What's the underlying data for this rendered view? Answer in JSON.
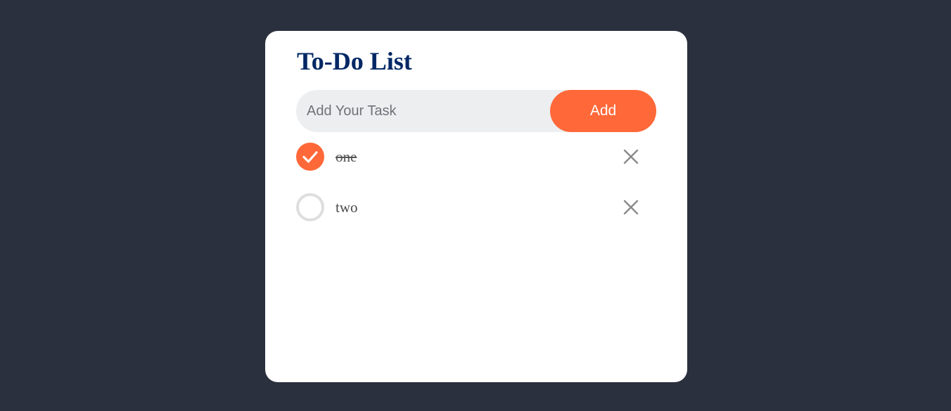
{
  "app": {
    "title": "To-Do List"
  },
  "input": {
    "placeholder": "Add Your Task",
    "value": ""
  },
  "add_button": {
    "label": "Add"
  },
  "tasks": [
    {
      "text": "one",
      "completed": true
    },
    {
      "text": "two",
      "completed": false
    }
  ],
  "icons": {
    "check": "check-icon",
    "delete": "close-icon"
  },
  "colors": {
    "background": "#2a303d",
    "card": "#ffffff",
    "title": "#002765",
    "accent": "#ff6838",
    "input_bg": "#edeef0",
    "unchecked_ring": "#dedede",
    "delete_icon": "#8a8a8a"
  }
}
